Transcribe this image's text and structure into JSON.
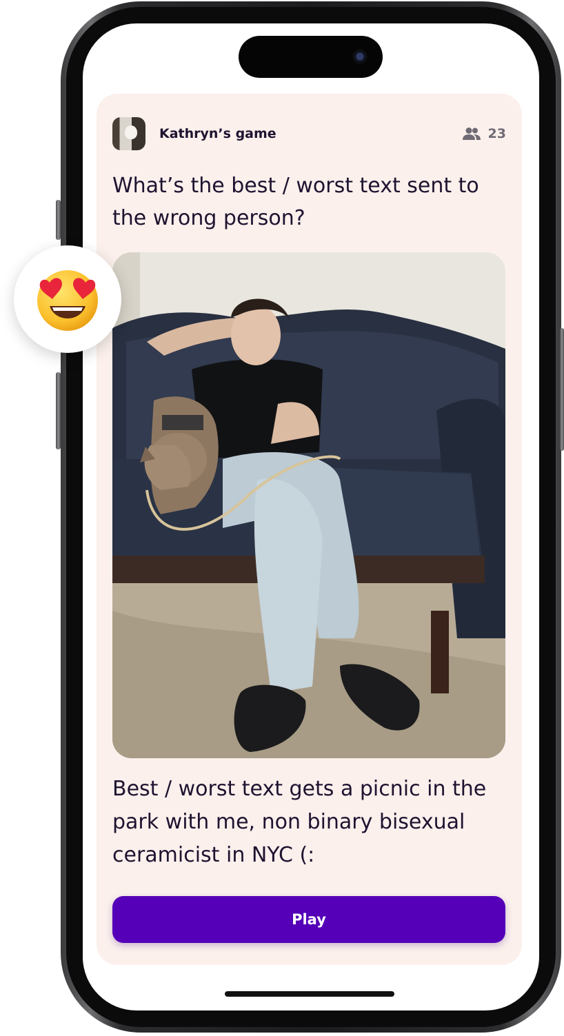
{
  "colors": {
    "card_background": "#fbf0ec",
    "primary_button": "#5500b8",
    "text_primary": "#1e1330",
    "text_muted": "#6f6a74"
  },
  "game": {
    "host_name": "Kathryn’s game",
    "players_icon": "people-icon",
    "player_count": "23"
  },
  "prompt": {
    "question": "What’s the best / worst text sent to the wrong person?"
  },
  "photo": {
    "icon": "photo-person-with-dog-on-couch"
  },
  "answer": {
    "text": "Best / worst text gets a picnic in the park with me, non binary bisexual ceramicist in NYC (:"
  },
  "actions": {
    "play_label": "Play"
  },
  "reaction": {
    "icon": "heart-eyes-emoji"
  }
}
